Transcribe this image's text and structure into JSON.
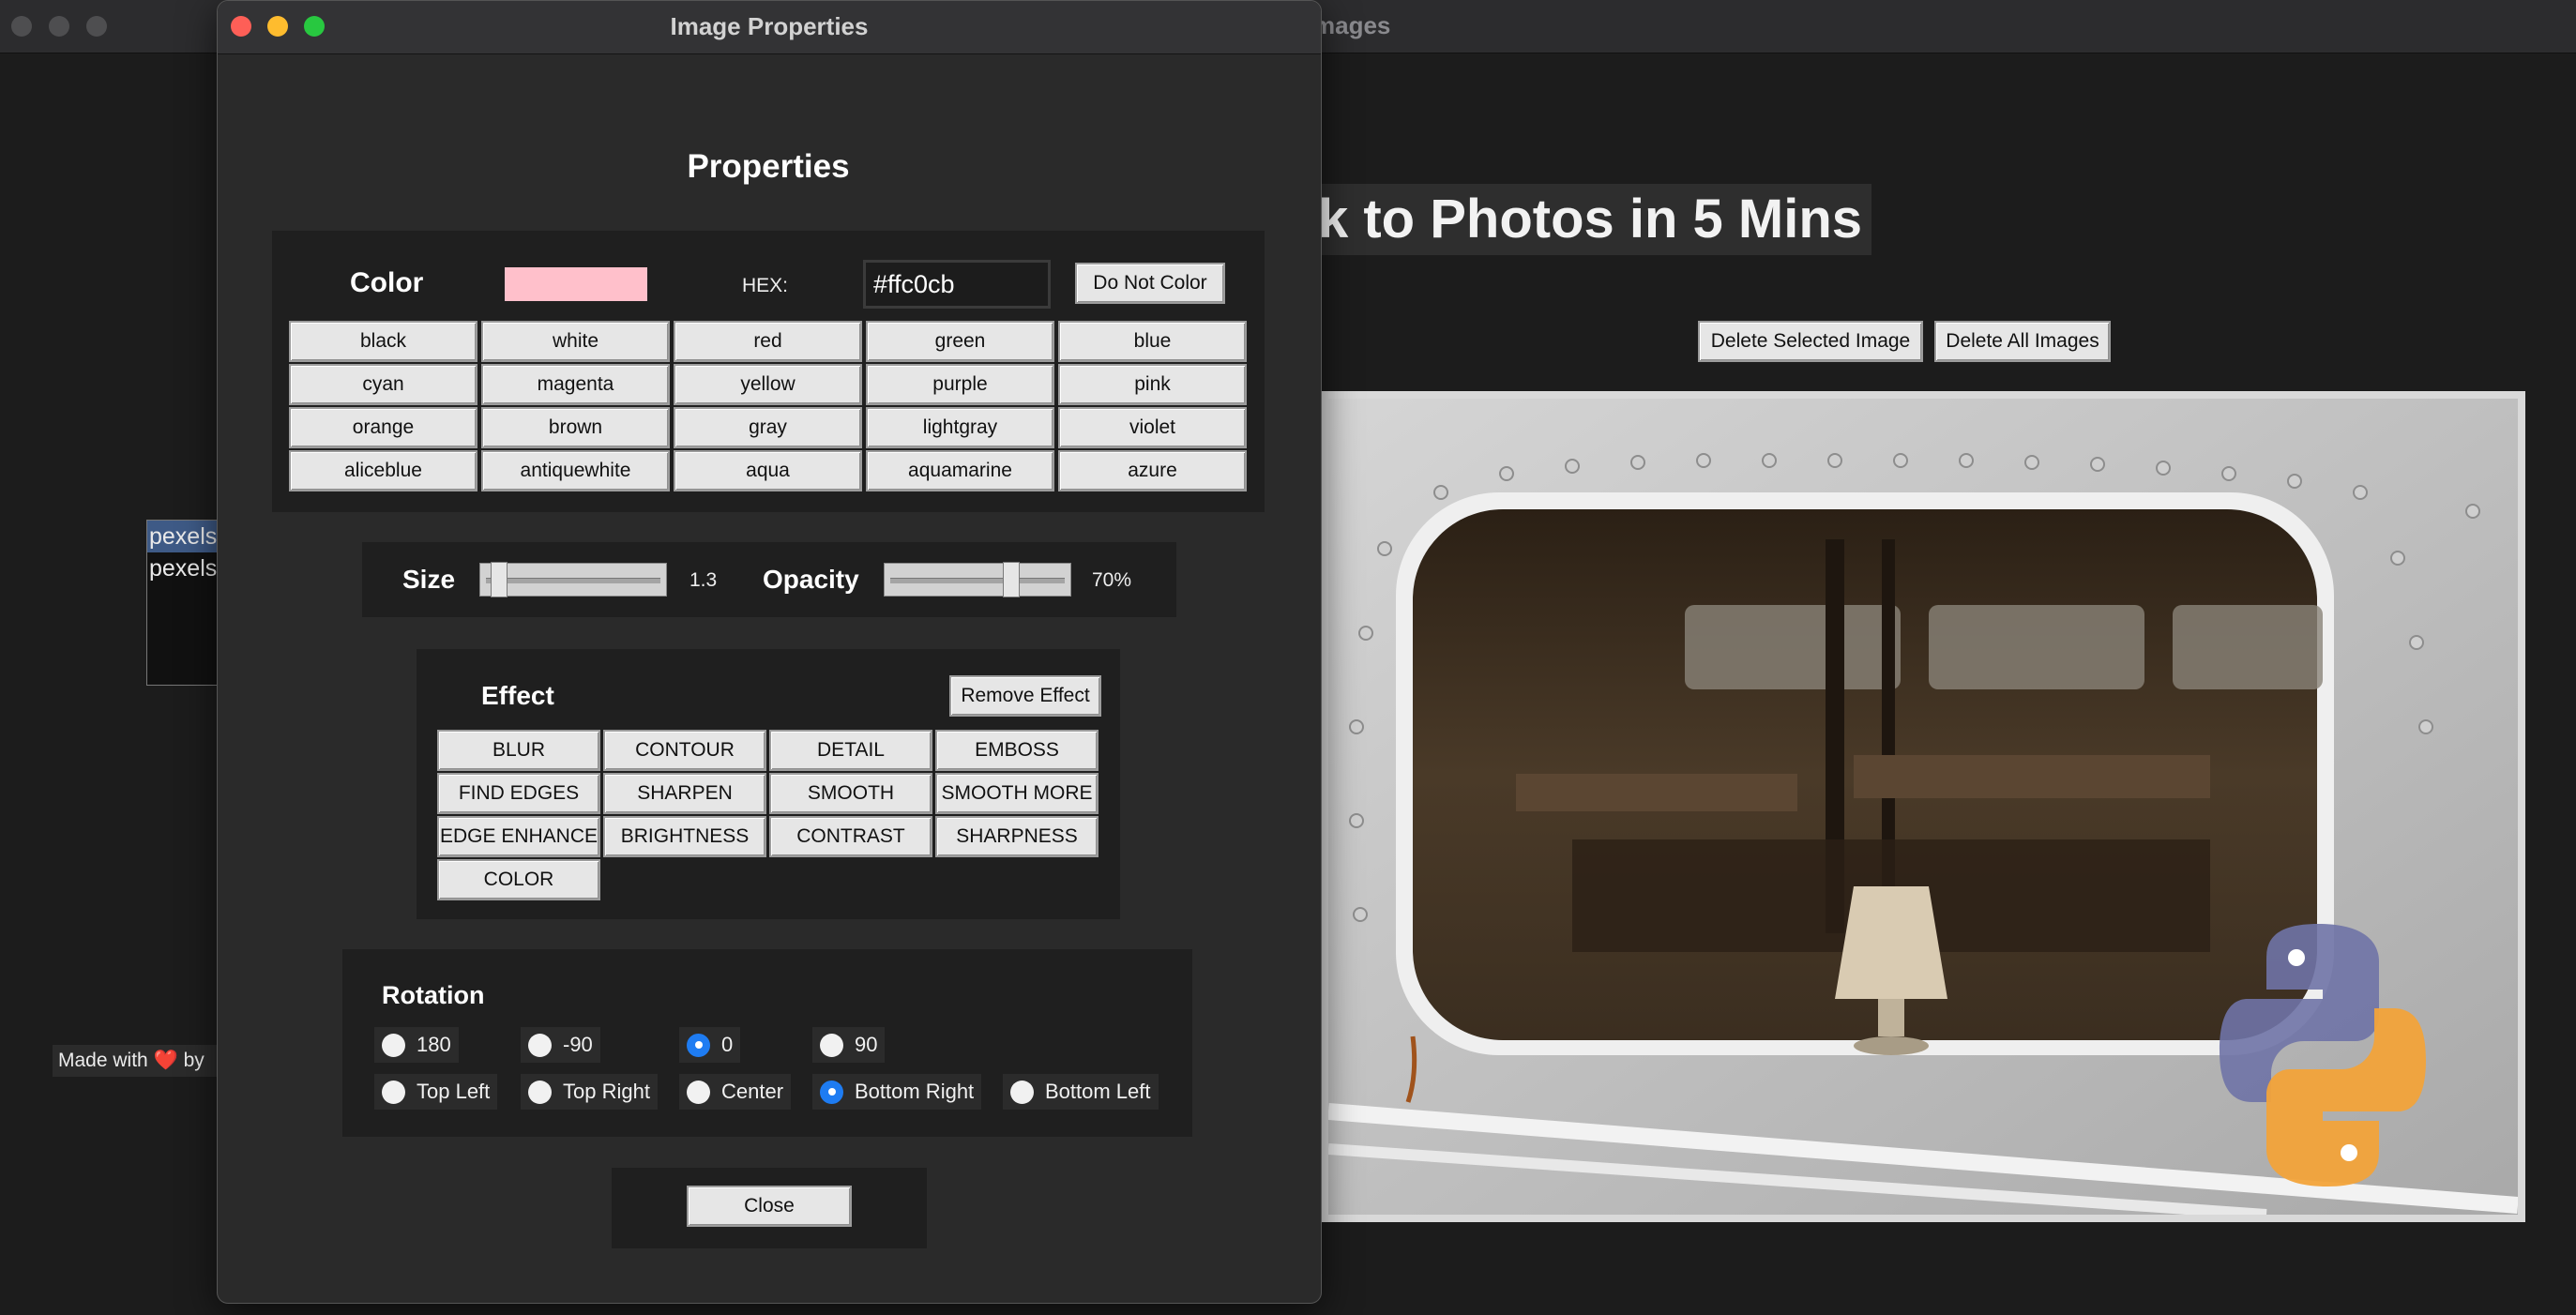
{
  "main_window": {
    "title_suffix": "mages",
    "heading_visible": "k to Photos in 5 Mins",
    "delete_selected_label": "Delete Selected Image",
    "delete_all_label": "Delete All Images",
    "file_list": [
      "pexels",
      "pexels"
    ],
    "credit_text": "Made with",
    "credit_heart": "❤️",
    "credit_by": "by"
  },
  "dialog": {
    "title": "Image Properties",
    "heading": "Properties",
    "color": {
      "label": "Color",
      "swatch_color": "#ffc0cb",
      "hex_label": "HEX:",
      "hex_value": "#ffc0cb",
      "no_color_label": "Do Not Color",
      "presets": [
        "black",
        "white",
        "red",
        "green",
        "blue",
        "cyan",
        "magenta",
        "yellow",
        "purple",
        "pink",
        "orange",
        "brown",
        "gray",
        "lightgray",
        "violet",
        "aliceblue",
        "antiquewhite",
        "aqua",
        "aquamarine",
        "azure"
      ]
    },
    "size": {
      "label": "Size",
      "value": "1.3",
      "fraction": 0.06
    },
    "opacity": {
      "label": "Opacity",
      "value": "70%",
      "fraction": 0.7
    },
    "effect": {
      "label": "Effect",
      "remove_label": "Remove Effect",
      "options": [
        "BLUR",
        "CONTOUR",
        "DETAIL",
        "EMBOSS",
        "FIND EDGES",
        "SHARPEN",
        "SMOOTH",
        "SMOOTH MORE",
        "EDGE ENHANCE",
        "BRIGHTNESS",
        "CONTRAST",
        "SHARPNESS",
        "COLOR"
      ]
    },
    "rotation": {
      "label": "Rotation",
      "angles": [
        "180",
        "-90",
        "0",
        "90"
      ],
      "selected_angle": "0",
      "positions": [
        "Top Left",
        "Top Right",
        "Center",
        "Bottom Right",
        "Bottom Left"
      ],
      "selected_position": "Bottom Right"
    },
    "close_label": "Close"
  },
  "colors": {
    "accent": "#1e7cf2",
    "traffic_red": "#fe5f57",
    "traffic_yellow": "#febc2e",
    "traffic_green": "#28c840"
  }
}
